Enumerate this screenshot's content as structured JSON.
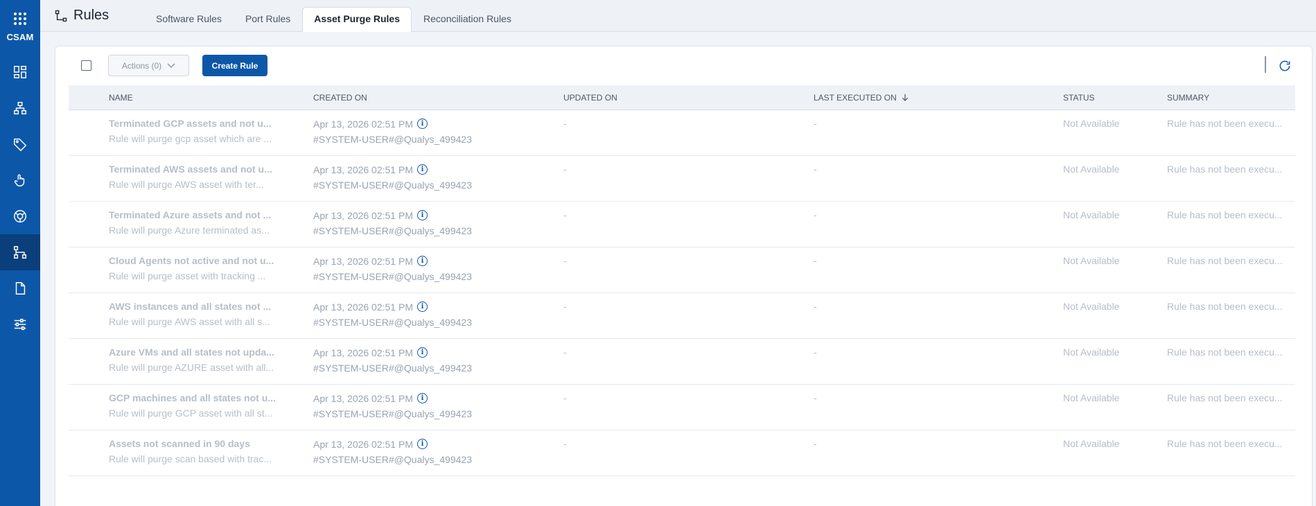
{
  "app": {
    "brand": "CSAM"
  },
  "page": {
    "title": "Rules"
  },
  "tabs": [
    {
      "label": "Software Rules",
      "active": false
    },
    {
      "label": "Port Rules",
      "active": false
    },
    {
      "label": "Asset Purge Rules",
      "active": true
    },
    {
      "label": "Reconciliation Rules",
      "active": false
    }
  ],
  "rail": {
    "items": [
      {
        "icon": "dashboard-icon"
      },
      {
        "icon": "inventory-icon"
      },
      {
        "icon": "tag-icon"
      },
      {
        "icon": "responses-icon"
      },
      {
        "icon": "eol-icon"
      },
      {
        "icon": "rules-icon",
        "active": true
      },
      {
        "icon": "reports-icon"
      },
      {
        "icon": "configuration-icon"
      }
    ]
  },
  "toolbar": {
    "actions_label": "Actions (0)",
    "create_label": "Create Rule"
  },
  "table": {
    "columns": [
      "NAME",
      "CREATED ON",
      "UPDATED ON",
      "LAST EXECUTED ON",
      "STATUS",
      "SUMMARY"
    ],
    "sort_column": "LAST EXECUTED ON",
    "rows": [
      {
        "name": "Terminated GCP assets and not u...",
        "desc": "Rule will purge gcp asset which are ...",
        "created_on": "Apr 13, 2026 02:51 PM",
        "created_by": "#SYSTEM-USER#@Qualys_499423",
        "updated_on": "-",
        "last_executed": "-",
        "status": "Not Available",
        "summary": "Rule has not been execu..."
      },
      {
        "name": "Terminated AWS assets and not u...",
        "desc": "Rule will purge AWS asset with ter...",
        "created_on": "Apr 13, 2026 02:51 PM",
        "created_by": "#SYSTEM-USER#@Qualys_499423",
        "updated_on": "-",
        "last_executed": "-",
        "status": "Not Available",
        "summary": "Rule has not been execu..."
      },
      {
        "name": "Terminated Azure assets and not ...",
        "desc": "Rule will purge Azure terminated as...",
        "created_on": "Apr 13, 2026 02:51 PM",
        "created_by": "#SYSTEM-USER#@Qualys_499423",
        "updated_on": "-",
        "last_executed": "-",
        "status": "Not Available",
        "summary": "Rule has not been execu..."
      },
      {
        "name": "Cloud Agents not active and not u...",
        "desc": "Rule will purge asset with tracking ...",
        "created_on": "Apr 13, 2026 02:51 PM",
        "created_by": "#SYSTEM-USER#@Qualys_499423",
        "updated_on": "-",
        "last_executed": "-",
        "status": "Not Available",
        "summary": "Rule has not been execu..."
      },
      {
        "name": "AWS instances and all states not ...",
        "desc": "Rule will purge AWS asset with all s...",
        "created_on": "Apr 13, 2026 02:51 PM",
        "created_by": "#SYSTEM-USER#@Qualys_499423",
        "updated_on": "-",
        "last_executed": "-",
        "status": "Not Available",
        "summary": "Rule has not been execu..."
      },
      {
        "name": "Azure VMs and all states not upda...",
        "desc": "Rule will purge AZURE asset with all...",
        "created_on": "Apr 13, 2026 02:51 PM",
        "created_by": "#SYSTEM-USER#@Qualys_499423",
        "updated_on": "-",
        "last_executed": "-",
        "status": "Not Available",
        "summary": "Rule has not been execu..."
      },
      {
        "name": "GCP machines and all states not u...",
        "desc": "Rule will purge GCP asset with all st...",
        "created_on": "Apr 13, 2026 02:51 PM",
        "created_by": "#SYSTEM-USER#@Qualys_499423",
        "updated_on": "-",
        "last_executed": "-",
        "status": "Not Available",
        "summary": "Rule has not been execu..."
      },
      {
        "name": "Assets not scanned in 90 days",
        "desc": "Rule will purge scan based with trac...",
        "created_on": "Apr 13, 2026 02:51 PM",
        "created_by": "#SYSTEM-USER#@Qualys_499423",
        "updated_on": "-",
        "last_executed": "-",
        "status": "Not Available",
        "summary": "Rule has not been execu..."
      }
    ]
  },
  "colors": {
    "brand": "#0d57a8",
    "rail_active": "#0a3f7b",
    "muted_text": "#b6bec8"
  }
}
